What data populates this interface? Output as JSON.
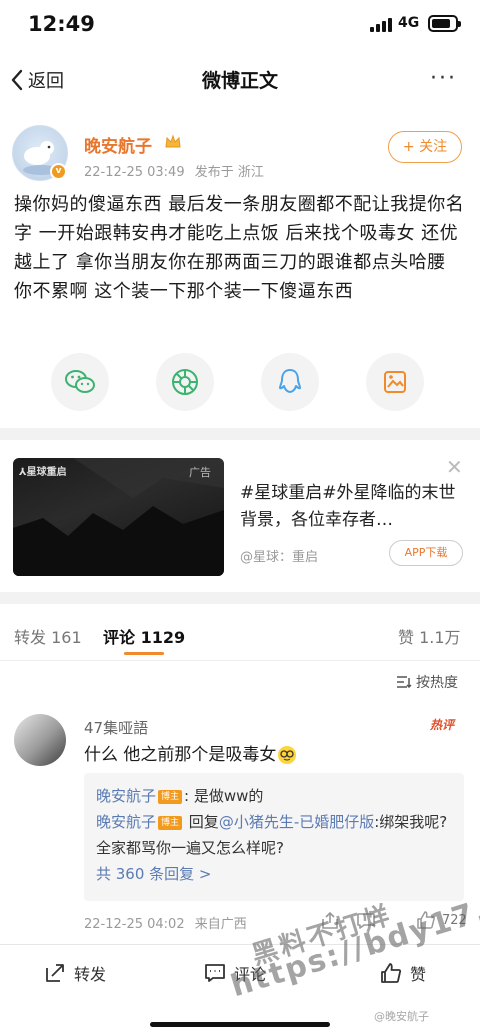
{
  "status_bar": {
    "time": "12:49",
    "network": "4G"
  },
  "nav": {
    "back_label": "返回",
    "title": "微博正文",
    "more_label": "···"
  },
  "post": {
    "author_name": "晚安航子",
    "verified_mark": "v",
    "date": "22-12-25 03:49",
    "location": "发布于 浙江",
    "follow_label": "+ 关注",
    "text": "操你妈的傻逼东西 最后发一条朋友圈都不配让我提你名字 一开始跟韩安冉才能吃上点饭 后来找个吸毒女 还优越上了 拿你当朋友你在那两面三刀的跟谁都点头哈腰 你不累啊 这个装一下那个装一下傻逼东西"
  },
  "share_icons": [
    "wechat-icon",
    "moments-icon",
    "qq-icon",
    "image-save-icon"
  ],
  "ad": {
    "logo_text": "⅄星球重启",
    "tag": "广告",
    "text": "#星球重启#外星降临的末世背景，各位幸存者…",
    "source": "@星球：重启",
    "button_label": "APP下载"
  },
  "tabs": {
    "repost": "转发 161",
    "comments": "评论 1129",
    "likes": "赞 1.1万"
  },
  "sort_label": "按热度",
  "comment": {
    "user": "47集哑語",
    "hot_tag": "热评",
    "text": "什么 他之前那个是吸毒女",
    "replies": [
      {
        "user": "晚安航子",
        "badge": "博主",
        "text": ": 是做ww的"
      },
      {
        "user": "晚安航子",
        "badge": "博主",
        "prefix": " 回复",
        "mention": "@小猪先生-已婚肥仔版",
        "text": ":绑架我呢? 全家都骂你一遍又怎么样呢?"
      }
    ],
    "more_replies": "共 360 条回复 >",
    "date": "22-12-25 04:02",
    "source": "来自广西",
    "likes": "722"
  },
  "bottom_bar": {
    "repost": "转发",
    "comment": "评论",
    "like": "赞"
  },
  "watermark": {
    "line1": "黑料不打烊",
    "line2": "https://bdy17.co",
    "small": "@晚安航子"
  },
  "colors": {
    "accent": "#f08a2a",
    "link": "#5b7bb3",
    "author": "#e8772e"
  }
}
